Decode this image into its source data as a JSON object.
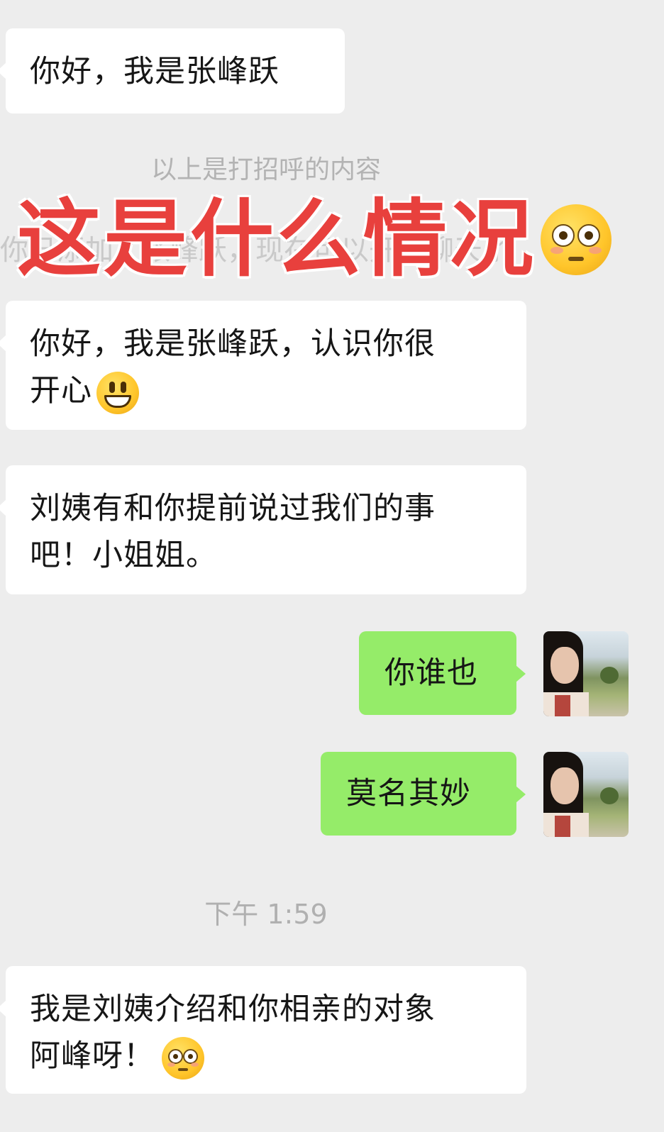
{
  "messages": {
    "m1": "你好，我是张峰跃",
    "system_note": "以上是打招呼的内容",
    "hidden_partial": "你已添加了张峰跃，现在可以开始聊天了",
    "m2_line1": "你好，我是张峰跃，认识你很",
    "m2_line2": "开心",
    "m3_line1": "刘姨有和你提前说过我们的事",
    "m3_line2": "吧！小姐姐。",
    "m4": "你谁也",
    "m5": "莫名其妙",
    "timestamp": "下午 1:59",
    "m6_line1": "我是刘姨介绍和你相亲的对象",
    "m6_line2": "阿峰呀！"
  },
  "overlay": {
    "caption": "这是什么情况"
  },
  "icons": {
    "flushed": "flushed-face-emoji",
    "smile": "grinning-face-emoji",
    "avatar": "user-avatar"
  },
  "colors": {
    "background": "#ededed",
    "incoming_bubble": "#ffffff",
    "outgoing_bubble": "#95ec69",
    "caption": "#e8403d"
  }
}
